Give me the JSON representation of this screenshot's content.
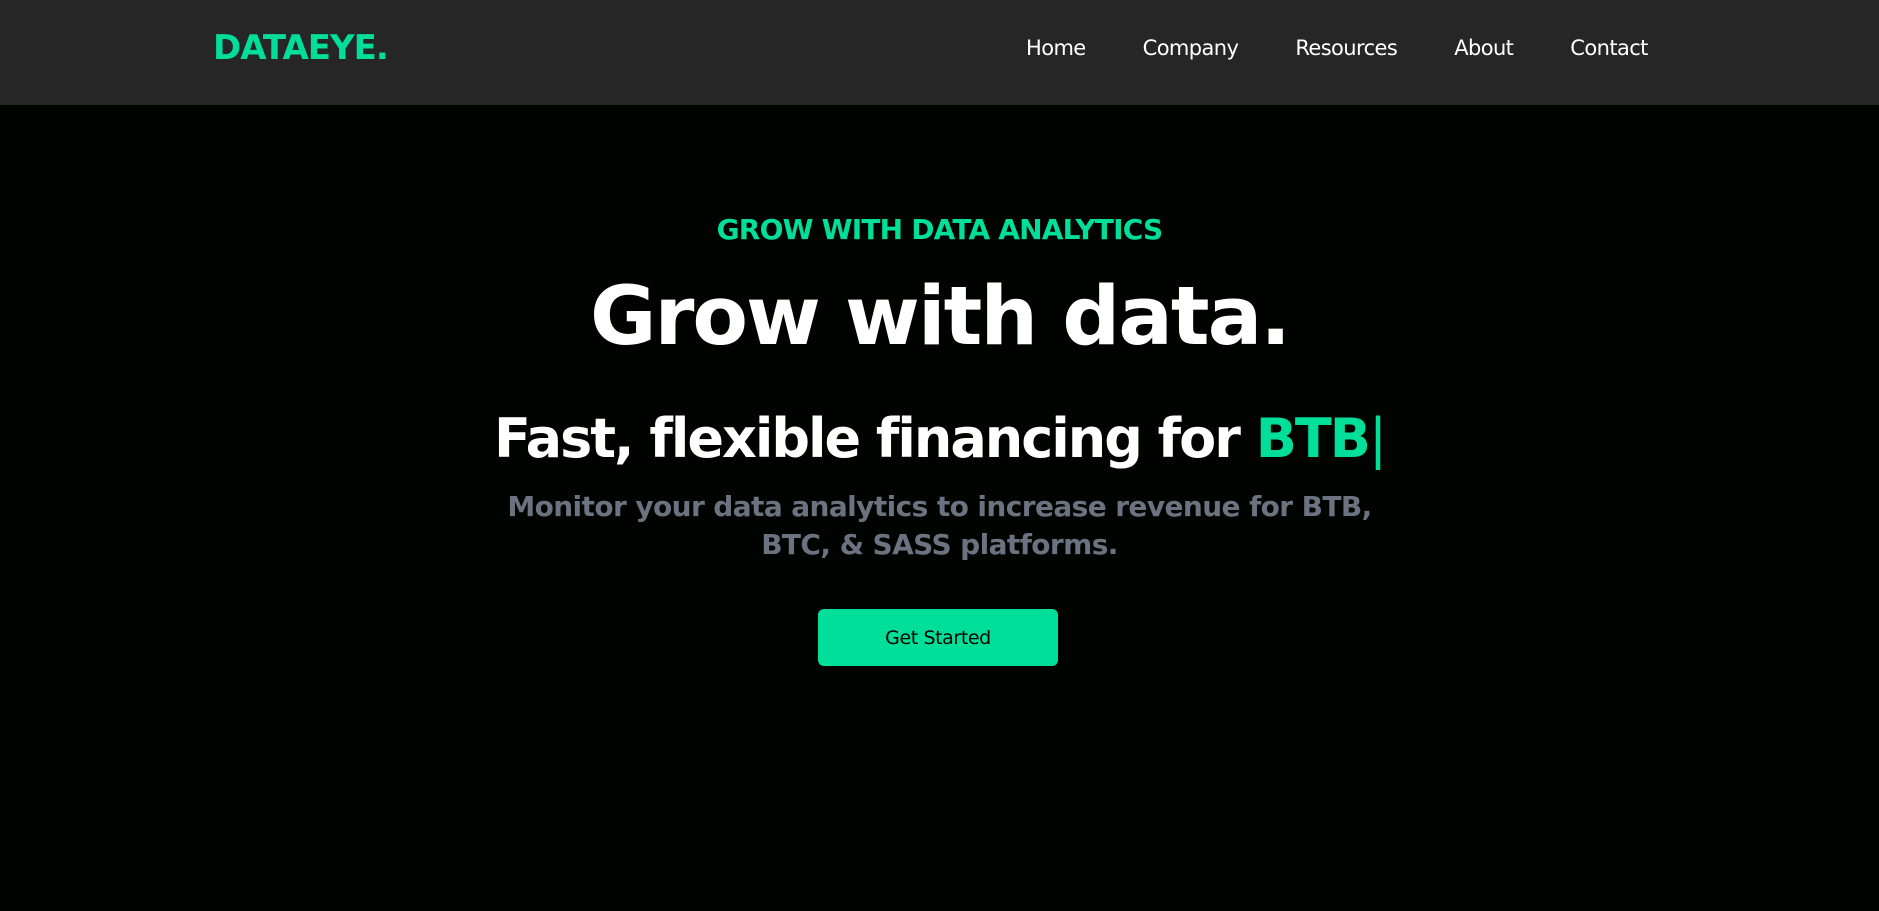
{
  "header": {
    "logo": "DATAEYE.",
    "nav": [
      "Home",
      "Company",
      "Resources",
      "About",
      "Contact"
    ]
  },
  "hero": {
    "eyebrow": "GROW WITH DATA ANALYTICS",
    "headline": "Grow with data.",
    "subheadline_prefix": "Fast, flexible financing for ",
    "subheadline_highlight": "BTB",
    "typing_cursor": "|",
    "description": "Monitor your data analytics to increase revenue for BTB, BTC, & SASS platforms.",
    "cta_label": "Get Started"
  },
  "colors": {
    "accent": "#00df9a",
    "nav_background": "#272627",
    "page_background": "#000300",
    "muted_text": "#6b7280"
  }
}
